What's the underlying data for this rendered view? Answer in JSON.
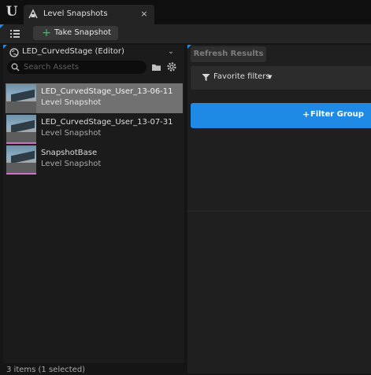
{
  "app": {
    "logo_icon": "unreal-logo-icon",
    "tab": {
      "icon": "camera-icon",
      "label": "Level Snapshots",
      "close_glyph": "×"
    }
  },
  "toolbar": {
    "menu_icon": "hamburger-icon",
    "take_snapshot": {
      "icon": "plus-icon",
      "plus_glyph": "+",
      "label": "Take Snapshot"
    }
  },
  "browser": {
    "level_icon": "world-icon",
    "level_dropdown": "LED_CurvedStage (Editor)",
    "chevron_glyph": "⌄",
    "search": {
      "icon": "search-icon",
      "placeholder": "Search Assets",
      "value": ""
    },
    "folder_icon": "folder-icon",
    "settings_icon": "gear-icon",
    "items": [
      {
        "name": "LED_CurvedStage_User_13-06-11",
        "type": "Level Snapshot",
        "selected": true
      },
      {
        "name": "LED_CurvedStage_User_13-07-31",
        "type": "Level Snapshot",
        "selected": false
      },
      {
        "name": "SnapshotBase",
        "type": "Level Snapshot",
        "selected": false
      }
    ],
    "status": "3 items (1 selected)"
  },
  "results": {
    "refresh_label": "Refresh Results",
    "favorite": {
      "icon": "filter-icon",
      "label": "Favorite filters",
      "caret_glyph": "▼"
    },
    "filter_group": {
      "plus_glyph": "+",
      "label": "Filter Group"
    }
  },
  "colors": {
    "accent_blue": "#1f8ae5",
    "add_green": "#2cc95e",
    "selection_gray": "#717171",
    "panel_bg": "#1b1b1b"
  }
}
